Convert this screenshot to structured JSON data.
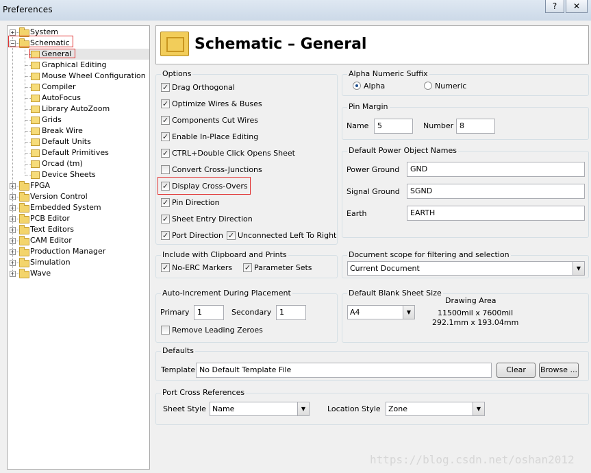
{
  "window": {
    "title": "Preferences",
    "help_label": "?",
    "close_label": "✕"
  },
  "tree": {
    "items": [
      {
        "label": "System",
        "level": 0,
        "expanded": false
      },
      {
        "label": "Schematic",
        "level": 0,
        "expanded": true
      },
      {
        "label": "General",
        "level": 1,
        "selected": true
      },
      {
        "label": "Graphical Editing",
        "level": 1
      },
      {
        "label": "Mouse Wheel Configuration",
        "level": 1
      },
      {
        "label": "Compiler",
        "level": 1
      },
      {
        "label": "AutoFocus",
        "level": 1
      },
      {
        "label": "Library AutoZoom",
        "level": 1
      },
      {
        "label": "Grids",
        "level": 1
      },
      {
        "label": "Break Wire",
        "level": 1
      },
      {
        "label": "Default Units",
        "level": 1
      },
      {
        "label": "Default Primitives",
        "level": 1
      },
      {
        "label": "Orcad (tm)",
        "level": 1
      },
      {
        "label": "Device Sheets",
        "level": 1
      },
      {
        "label": "FPGA",
        "level": 0,
        "expanded": false
      },
      {
        "label": "Version Control",
        "level": 0,
        "expanded": false
      },
      {
        "label": "Embedded System",
        "level": 0,
        "expanded": false
      },
      {
        "label": "PCB Editor",
        "level": 0,
        "expanded": false
      },
      {
        "label": "Text Editors",
        "level": 0,
        "expanded": false
      },
      {
        "label": "CAM Editor",
        "level": 0,
        "expanded": false
      },
      {
        "label": "Production Manager",
        "level": 0,
        "expanded": false
      },
      {
        "label": "Simulation",
        "level": 0,
        "expanded": false
      },
      {
        "label": "Wave",
        "level": 0,
        "expanded": false
      }
    ]
  },
  "header": {
    "title": "Schematic – General"
  },
  "options": {
    "label": "Options",
    "items": [
      {
        "label": "Drag Orthogonal",
        "checked": true
      },
      {
        "label": "Optimize Wires & Buses",
        "checked": true
      },
      {
        "label": "Components Cut Wires",
        "checked": true
      },
      {
        "label": "Enable In-Place Editing",
        "checked": true
      },
      {
        "label": "CTRL+Double Click Opens Sheet",
        "checked": true
      },
      {
        "label": "Convert Cross-Junctions",
        "checked": false
      },
      {
        "label": "Display Cross-Overs",
        "checked": true
      },
      {
        "label": "Pin Direction",
        "checked": true
      },
      {
        "label": "Sheet Entry Direction",
        "checked": true
      },
      {
        "label": "Port Direction",
        "checked": true
      },
      {
        "label": "Unconnected Left To Right",
        "checked": true
      }
    ]
  },
  "alpha_suffix": {
    "label": "Alpha Numeric Suffix",
    "alpha": "Alpha",
    "numeric": "Numeric",
    "selected": "Alpha"
  },
  "pin_margin": {
    "label": "Pin Margin",
    "name_label": "Name",
    "name_value": "5",
    "number_label": "Number",
    "number_value": "8"
  },
  "power_names": {
    "label": "Default Power Object Names",
    "power_ground_label": "Power Ground",
    "power_ground_value": "GND",
    "signal_ground_label": "Signal Ground",
    "signal_ground_value": "SGND",
    "earth_label": "Earth",
    "earth_value": "EARTH"
  },
  "clipboard": {
    "label": "Include with Clipboard and Prints",
    "no_erc": "No-ERC Markers",
    "param_sets": "Parameter Sets"
  },
  "doc_scope": {
    "label": "Document scope for filtering and selection",
    "value": "Current Document"
  },
  "auto_increment": {
    "label": "Auto-Increment During Placement",
    "primary_label": "Primary",
    "primary_value": "1",
    "secondary_label": "Secondary",
    "secondary_value": "1",
    "remove_zeroes": "Remove Leading Zeroes"
  },
  "blank_sheet": {
    "label": "Default Blank Sheet Size",
    "value": "A4",
    "drawing_area_label": "Drawing Area",
    "size_mil": "11500mil x 7600mil",
    "size_mm": "292.1mm x 193.04mm"
  },
  "defaults": {
    "label": "Defaults",
    "template_label": "Template",
    "template_value": "No Default Template File",
    "clear_label": "Clear",
    "browse_label": "Browse ..."
  },
  "port_refs": {
    "label": "Port Cross References",
    "sheet_style_label": "Sheet Style",
    "sheet_style_value": "Name",
    "location_style_label": "Location Style",
    "location_style_value": "Zone"
  },
  "watermark": "https://blog.csdn.net/oshan2012",
  "colors": {
    "highlight": "#e03030",
    "check": "#222222"
  }
}
